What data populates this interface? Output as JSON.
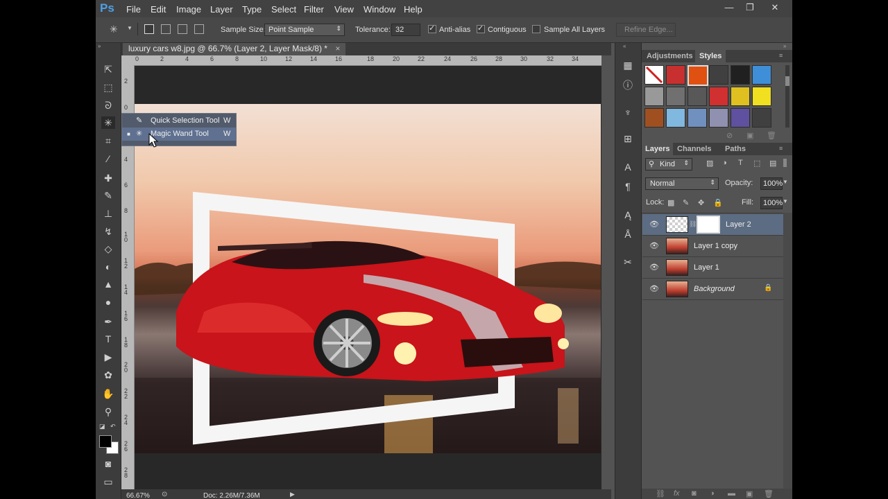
{
  "app": {
    "logo": "Ps",
    "window_controls": [
      "—",
      "❐",
      "✕"
    ]
  },
  "menu": [
    "File",
    "Edit",
    "Image",
    "Layer",
    "Type",
    "Select",
    "Filter",
    "View",
    "Window",
    "Help"
  ],
  "options_bar": {
    "sample_size_label": "Sample Size:",
    "sample_size_value": "Point Sample",
    "tolerance_label": "Tolerance:",
    "tolerance_value": "32",
    "anti_alias": "Anti-alias",
    "contiguous": "Contiguous",
    "sample_all_layers": "Sample All Layers",
    "refine_edge": "Refine Edge..."
  },
  "document": {
    "tab_title": "luxury cars w8.jpg @ 66.7% (Layer 2, Layer Mask/8) *",
    "close_glyph": "×",
    "ruler_top": [
      "0",
      "2",
      "4",
      "6",
      "8",
      "10",
      "12",
      "14",
      "16",
      "18",
      "20",
      "22",
      "24",
      "26",
      "28",
      "30",
      "32",
      "34"
    ],
    "ruler_left": [
      "2",
      "0",
      "2",
      "4",
      "6",
      "8",
      "1\n0",
      "1\n2",
      "1\n4",
      "1\n6",
      "1\n8",
      "2\n0",
      "2\n2",
      "2\n4",
      "2\n6",
      "2\n8"
    ]
  },
  "tool_flyout": {
    "items": [
      {
        "label": "Quick Selection Tool",
        "shortcut": "W"
      },
      {
        "label": "Magic Wand Tool",
        "shortcut": "W"
      }
    ]
  },
  "status_bar": {
    "zoom": "66.67%",
    "doc": "Doc: 2.26M/7.36M"
  },
  "styles_panel": {
    "tabs": [
      "Adjustments",
      "Styles"
    ],
    "swatches": [
      "#c83030",
      "#e05010",
      "#404040",
      "#202020",
      "#3f8fd8",
      "#999999",
      "#707070",
      "#585858",
      "#d03030",
      "#e0c020",
      "#f0e020",
      "#a05020",
      "#80b8e0",
      "#7090c0",
      "#9090b0",
      "#6050a0",
      "#404040"
    ]
  },
  "layers_panel": {
    "tabs": [
      "Layers",
      "Channels",
      "Paths"
    ],
    "kind_label": "Kind",
    "blend_mode": "Normal",
    "opacity_label": "Opacity:",
    "opacity_value": "100%",
    "lock_label": "Lock:",
    "fill_label": "Fill:",
    "fill_value": "100%",
    "layers": [
      {
        "name": "Layer 2",
        "selected": true
      },
      {
        "name": "Layer 1 copy",
        "selected": false
      },
      {
        "name": "Layer 1",
        "selected": false
      },
      {
        "name": "Background",
        "selected": false
      }
    ]
  }
}
